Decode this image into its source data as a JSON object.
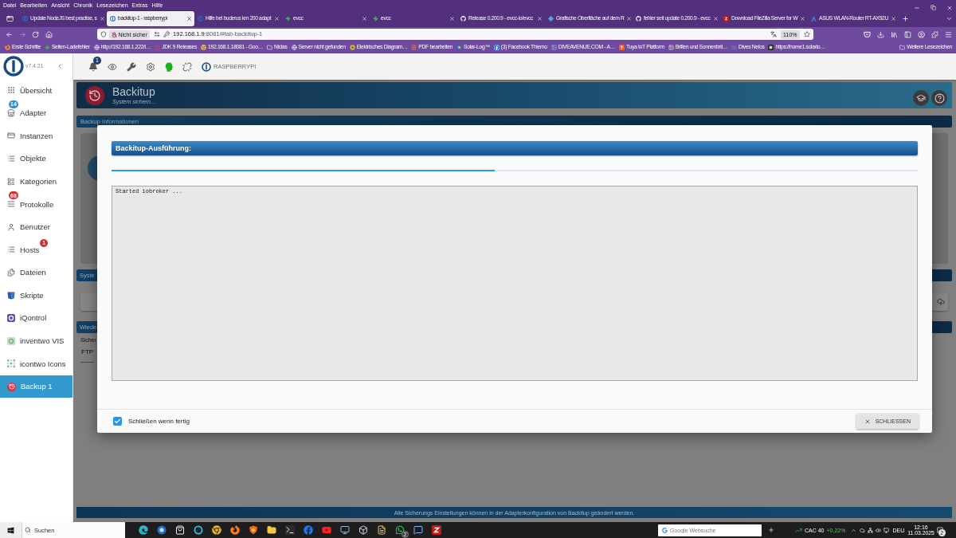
{
  "menu_bar": [
    "Datei",
    "Bearbeiten",
    "Ansicht",
    "Chronik",
    "Lesezeichen",
    "Extras",
    "Hilfe"
  ],
  "tabs": [
    {
      "title": "Update NodeJS best practise, s",
      "selected": false
    },
    {
      "title": "backitup-1 - raspberrypi",
      "selected": true
    },
    {
      "title": "Hilfe bei buderus km 200 adapt",
      "selected": false
    },
    {
      "title": "evcc",
      "selected": false
    },
    {
      "title": "evcc",
      "selected": false
    },
    {
      "title": "Release 0.200.9 - evcc-io/evcc",
      "selected": false
    },
    {
      "title": "Grafische Oberfläche auf dem R",
      "selected": false
    },
    {
      "title": "fehler seit update 0.200.9 - evcc",
      "selected": false
    },
    {
      "title": "Download FileZilla Server for W",
      "selected": false
    },
    {
      "title": "ASUS WLAN-Router RT-AX92U",
      "selected": false
    }
  ],
  "address_bar": {
    "security_label": "Nicht sicher",
    "url_host": "192.168.1.9",
    "url_path": ":8081/#tab-backitup-1",
    "zoom": "110%"
  },
  "bookmarks": [
    "Erste Schritte",
    "Seiten-Ladefehler",
    "http://192.168.1.222/i…",
    "JDK 9 Releases",
    "192.168.1.18081 - Goo…",
    "Niclas",
    "Server nicht gefunden",
    "Elektrisches Diagram…",
    "PDF bearbeiten",
    "Solar-Log™",
    "(3) Facebook Thiemo",
    "DIVEAVENUE.COM - A…",
    "Tuya IoT Platform",
    "Brillen und Sonnenbril…",
    "Dives Nelos",
    "https://home1.solarlo…"
  ],
  "bookmarks_more": "Weitere Lesezeichen",
  "sidebar": {
    "version": "v7.4.21",
    "items": [
      {
        "label": "Übersicht",
        "selected": false
      },
      {
        "label": "Adapter",
        "selected": false,
        "badge": {
          "text": "14",
          "color": "#3390d0"
        }
      },
      {
        "label": "Instanzen",
        "selected": false
      },
      {
        "label": "Objekte",
        "selected": false
      },
      {
        "label": "Kategorien",
        "selected": false
      },
      {
        "label": "Protokolle",
        "selected": false,
        "badge": {
          "text": "68",
          "color": "#d32f2f"
        }
      },
      {
        "label": "Benutzer",
        "selected": false
      },
      {
        "label": "Hosts",
        "selected": false,
        "badge": {
          "text": "1",
          "color": "#d32f2f"
        }
      },
      {
        "label": "Dateien",
        "selected": false
      },
      {
        "label": "Skripte",
        "selected": false
      },
      {
        "label": "iQontrol",
        "selected": false
      },
      {
        "label": "inventwo VIS",
        "selected": false
      },
      {
        "label": "icontwo Icons",
        "selected": false
      },
      {
        "label": "Backup 1",
        "selected": true
      }
    ]
  },
  "toolbar": {
    "notification_count": "1",
    "host": "RASPBERRYPI"
  },
  "backup_page": {
    "title": "Backitup",
    "subtitle": "System sichern…",
    "sections": [
      "Backup Informationen",
      "Syste",
      "Wiede"
    ],
    "storage_label": "Sicher",
    "storage_value": "FTP",
    "footer": "Alle Sicherungs Einstellungen können in der Adapterkonfiguration von Backitup geändert werden."
  },
  "dialog": {
    "title": "Backitup-Ausführung:",
    "progress": {
      "level": 0.475
    },
    "log": "Started iobroker ...",
    "close_when_done": {
      "label": "Schließen wenn fertig",
      "checked": true
    },
    "close_button": "SCHLIESSEN"
  },
  "taskbar": {
    "search_placeholder": "Suchen",
    "app_badge": "2",
    "web_search_placeholder": "Google Websuche",
    "stock_name": "CAC 40",
    "stock_change": "+0,22%",
    "language": "DEU",
    "time": "12:16",
    "date": "11.03.2025",
    "notification_count": "2"
  }
}
